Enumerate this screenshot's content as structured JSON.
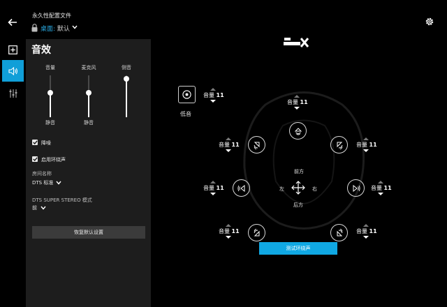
{
  "header": {
    "profile_label": "永久性配置文件",
    "profile_prefix": "桌面:",
    "profile_value": "默认"
  },
  "panel": {
    "title": "音效",
    "sliders": [
      {
        "label": "音量",
        "mute": "静音",
        "level": 0.58
      },
      {
        "label": "麦克风",
        "mute": "静音",
        "level": 0.58
      },
      {
        "label": "侧音",
        "mute": "",
        "level": 0.92
      }
    ],
    "noise_reduction": {
      "label": "降噪",
      "checked": true
    },
    "surround": {
      "label": "启用环绕声",
      "checked": true
    },
    "room": {
      "label": "房间名称",
      "value": "DTS 标准"
    },
    "stereo": {
      "label": "DTS SUPER STEREO 模式",
      "value": "前"
    },
    "reset_label": "恢复默认设置"
  },
  "main": {
    "subwoofer_label": "低音",
    "volume_word": "音量",
    "speakers": [
      {
        "id": "sub",
        "value": "11"
      },
      {
        "id": "center",
        "value": "11"
      },
      {
        "id": "front-left",
        "value": "11"
      },
      {
        "id": "front-right",
        "value": "11"
      },
      {
        "id": "side-left",
        "value": "11"
      },
      {
        "id": "side-right",
        "value": "11"
      },
      {
        "id": "rear-left",
        "value": "11"
      },
      {
        "id": "rear-right",
        "value": "11"
      }
    ],
    "directions": {
      "front": "前方",
      "back": "后方",
      "left": "左",
      "right": "右"
    },
    "test_label": "测试环绕声"
  },
  "colors": {
    "accent": "#10a8e3",
    "panel": "#1d1d1d",
    "background": "#000000"
  }
}
